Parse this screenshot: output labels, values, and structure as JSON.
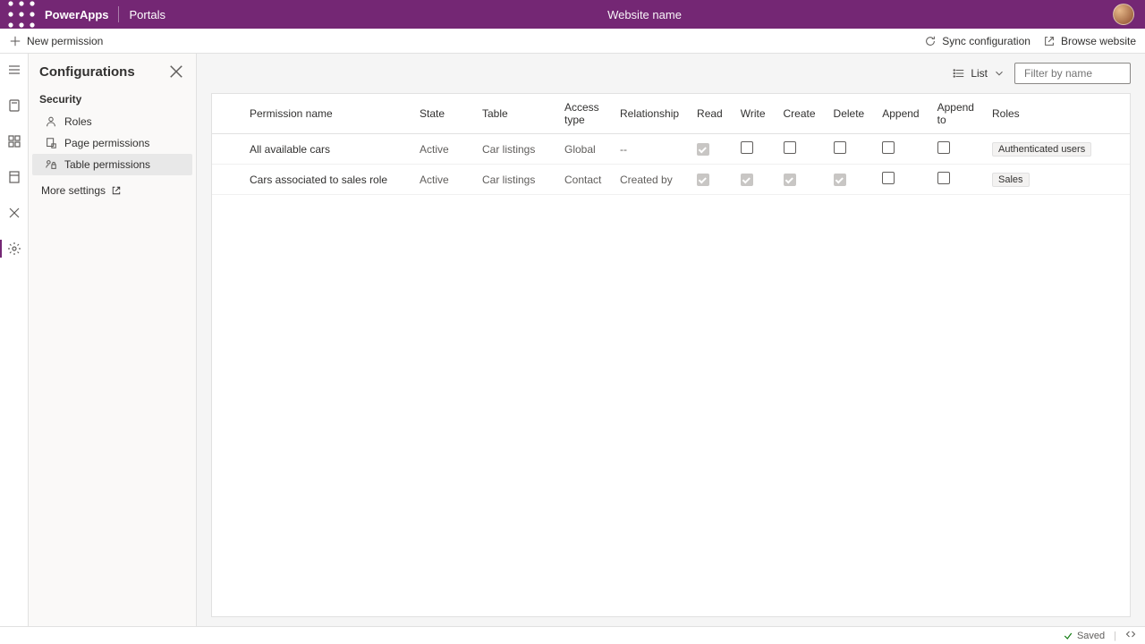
{
  "topbar": {
    "brand": "PowerApps",
    "product": "Portals",
    "website_name": "Website name"
  },
  "cmdbar": {
    "new_permission": "New permission",
    "sync_config": "Sync configuration",
    "browse_website": "Browse website"
  },
  "panel": {
    "title": "Configurations",
    "section": "Security",
    "items": [
      {
        "label": "Roles"
      },
      {
        "label": "Page permissions"
      },
      {
        "label": "Table permissions"
      }
    ],
    "more_settings": "More settings"
  },
  "tools": {
    "list_label": "List",
    "filter_placeholder": "Filter by name"
  },
  "table": {
    "headers": {
      "permission_name": "Permission name",
      "state": "State",
      "table": "Table",
      "access_type": "Access type",
      "relationship": "Relationship",
      "read": "Read",
      "write": "Write",
      "create": "Create",
      "delete": "Delete",
      "append": "Append",
      "append_to": "Append to",
      "roles": "Roles"
    },
    "rows": [
      {
        "name": "All available cars",
        "state": "Active",
        "table": "Car listings",
        "access": "Global",
        "relationship": "--",
        "perms": {
          "read": true,
          "write": false,
          "create": false,
          "delete": false,
          "append": false,
          "append_to": false
        },
        "role": "Authenticated users"
      },
      {
        "name": "Cars associated to sales role",
        "state": "Active",
        "table": "Car listings",
        "access": "Contact",
        "relationship": "Created by",
        "perms": {
          "read": true,
          "write": true,
          "create": true,
          "delete": true,
          "append": false,
          "append_to": false
        },
        "role": "Sales"
      }
    ]
  },
  "statusbar": {
    "saved": "Saved"
  }
}
